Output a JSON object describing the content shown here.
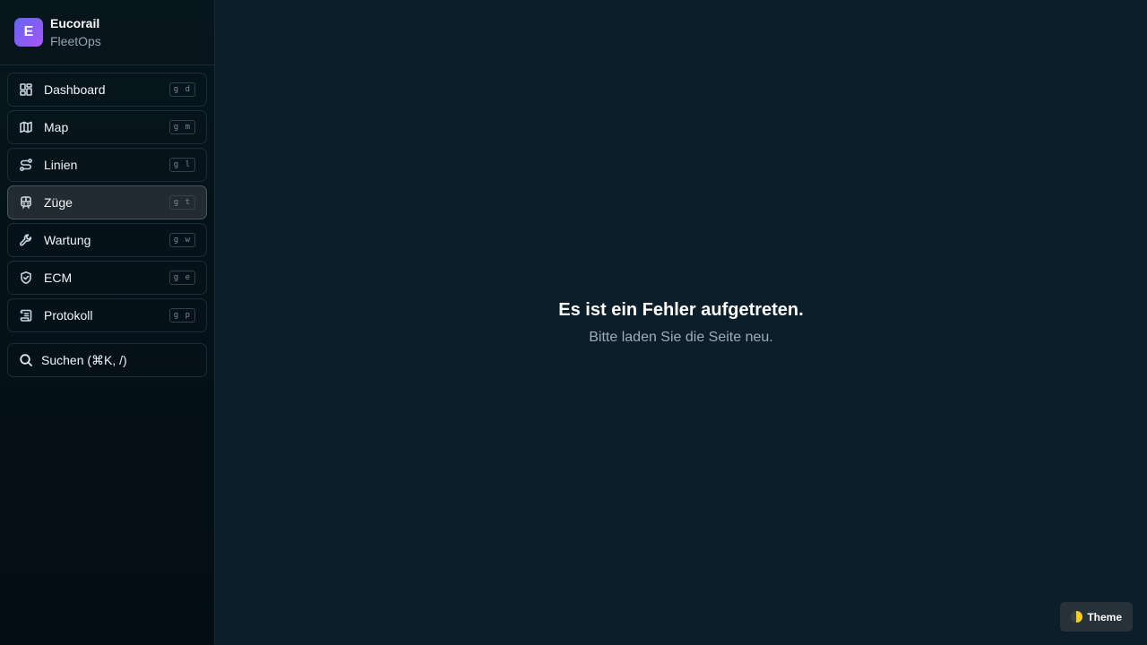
{
  "brand": {
    "logo_letter": "E",
    "name": "Eucorail",
    "subtitle": "FleetOps"
  },
  "nav": [
    {
      "label": "Dashboard",
      "shortcut": "g d",
      "icon": "dashboard-icon",
      "active": false
    },
    {
      "label": "Map",
      "shortcut": "g m",
      "icon": "map-icon",
      "active": false
    },
    {
      "label": "Linien",
      "shortcut": "g l",
      "icon": "route-icon",
      "active": false
    },
    {
      "label": "Züge",
      "shortcut": "g t",
      "icon": "train-icon",
      "active": true
    },
    {
      "label": "Wartung",
      "shortcut": "g w",
      "icon": "wrench-icon",
      "active": false
    },
    {
      "label": "ECM",
      "shortcut": "g e",
      "icon": "shield-icon",
      "active": false
    },
    {
      "label": "Protokoll",
      "shortcut": "g p",
      "icon": "scroll-icon",
      "active": false
    }
  ],
  "search": {
    "label": "Suchen (⌘K, /)",
    "icon": "search-icon"
  },
  "main": {
    "error_title": "Es ist ein Fehler aufgetreten.",
    "error_subtitle": "Bitte laden Sie die Seite neu."
  },
  "theme_button": {
    "label": "Theme",
    "icon": "half-moon-icon"
  },
  "colors": {
    "accent": "#6366f1",
    "background": "#0c1e29",
    "sidebar": "#07151d"
  }
}
